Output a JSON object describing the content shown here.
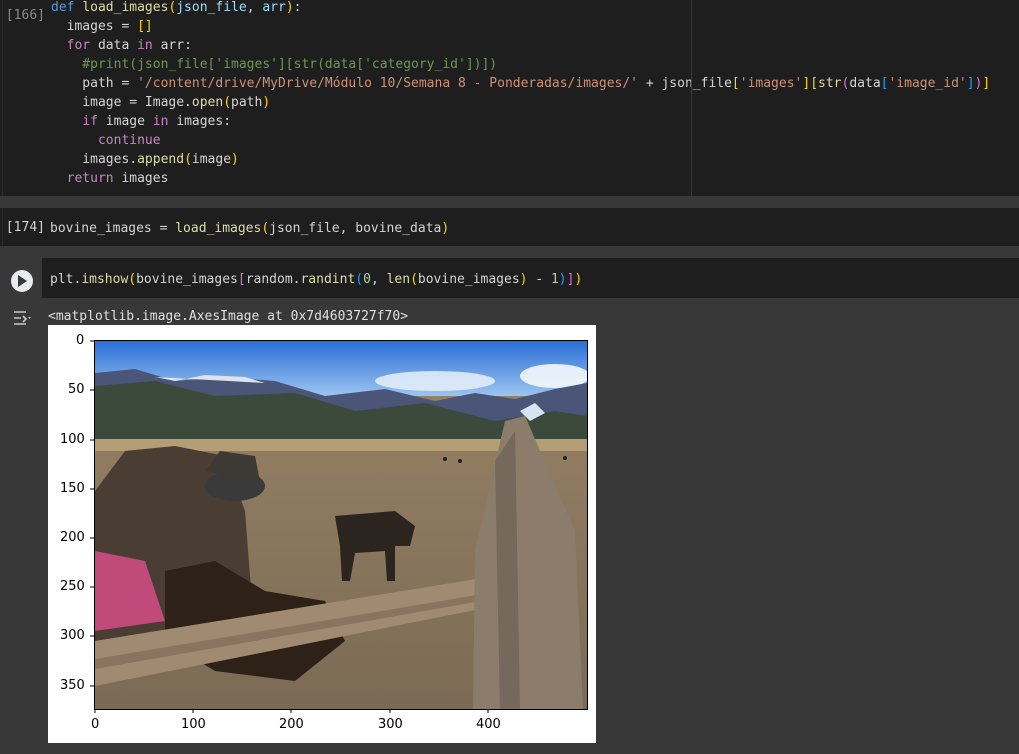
{
  "cells": [
    {
      "exec_count": "[166]",
      "lines": [
        "def load_images(json_file, arr):",
        "  images = []",
        "  for data in arr:",
        "    #print(json_file['images'][str(data['category_id'])])",
        "    path = '/content/drive/MyDrive/Módulo 10/Semana 8 - Ponderadas/images/' + json_file['images'][str(data['image_id'])]",
        "    image = Image.open(path)",
        "    if image in images:",
        "      continue",
        "    images.append(image)",
        "  return images"
      ]
    },
    {
      "exec_count": "[174]",
      "lines": [
        "bovine_images = load_images(json_file, bovine_data)"
      ]
    },
    {
      "exec_count": "",
      "lines": [
        "plt.imshow(bovine_images[random.randint(0, len(bovine_images) - 1)])"
      ],
      "output_text": "<matplotlib.image.AxesImage at 0x7d4603727f70>"
    }
  ],
  "plot": {
    "y_ticks": [
      "0",
      "50",
      "100",
      "150",
      "200",
      "250",
      "300",
      "350"
    ],
    "x_ticks": [
      "0",
      "100",
      "200",
      "300",
      "400"
    ],
    "image_description_icon": "photo-cowboy-calf-fence"
  }
}
